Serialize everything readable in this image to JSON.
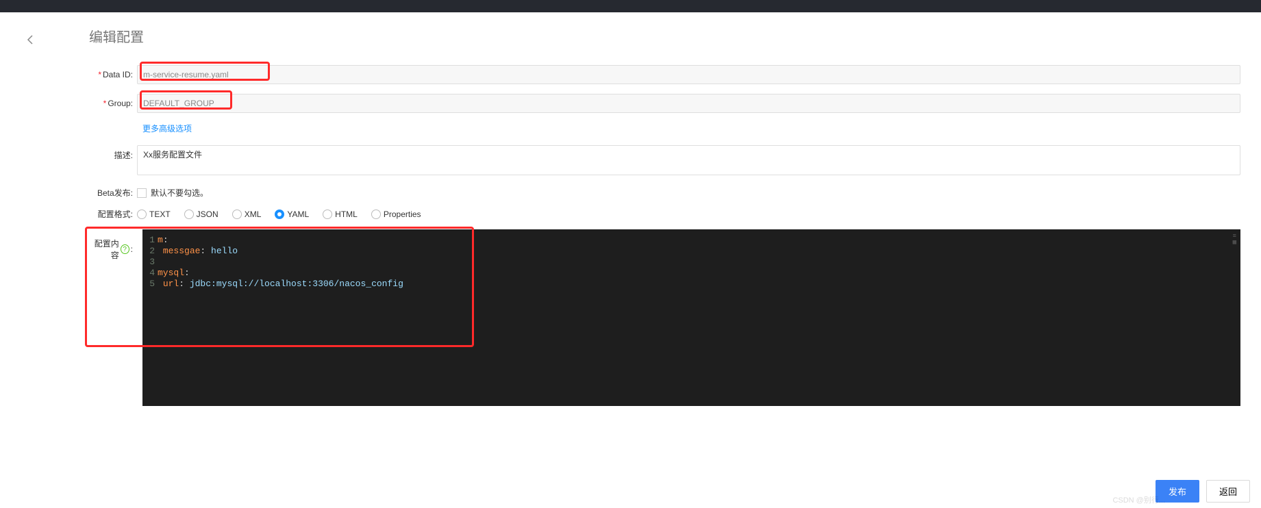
{
  "page": {
    "title": "编辑配置"
  },
  "form": {
    "data_id": {
      "label": "Data ID:",
      "value": "m-service-resume.yaml"
    },
    "group": {
      "label": "Group:",
      "value": "DEFAULT_GROUP"
    },
    "more_link": "更多高级选项",
    "desc": {
      "label": "描述:",
      "value": "Xx服务配置文件"
    },
    "beta": {
      "label": "Beta发布:",
      "hint": "默认不要勾选。"
    },
    "format": {
      "label": "配置格式:",
      "options": [
        "TEXT",
        "JSON",
        "XML",
        "YAML",
        "HTML",
        "Properties"
      ],
      "selected": "YAML"
    }
  },
  "editor": {
    "label": "配置内容",
    "help_glyph": "?",
    "colon": ":",
    "line_numbers": [
      "1",
      "2",
      "3",
      "4",
      "5"
    ],
    "code_lines": [
      {
        "segments": [
          {
            "cls": "tok-key",
            "t": "m"
          },
          {
            "cls": "tok-punc",
            "t": ":"
          }
        ]
      },
      {
        "segments": [
          {
            "cls": "",
            "t": " "
          },
          {
            "cls": "tok-key",
            "t": "messgae"
          },
          {
            "cls": "tok-punc",
            "t": ":"
          },
          {
            "cls": "tok-str",
            "t": " hello"
          }
        ]
      },
      {
        "segments": [
          {
            "cls": "",
            "t": ""
          }
        ]
      },
      {
        "segments": [
          {
            "cls": "tok-key",
            "t": "mysql"
          },
          {
            "cls": "tok-punc",
            "t": ":"
          }
        ]
      },
      {
        "segments": [
          {
            "cls": "",
            "t": " "
          },
          {
            "cls": "tok-key",
            "t": "url"
          },
          {
            "cls": "tok-punc",
            "t": ":"
          },
          {
            "cls": "tok-str",
            "t": " jdbc:mysql://localhost:3306/nacos_config"
          }
        ]
      }
    ]
  },
  "buttons": {
    "publish": "发布",
    "back": "返回"
  },
  "watermark": "CSDN @别行..."
}
